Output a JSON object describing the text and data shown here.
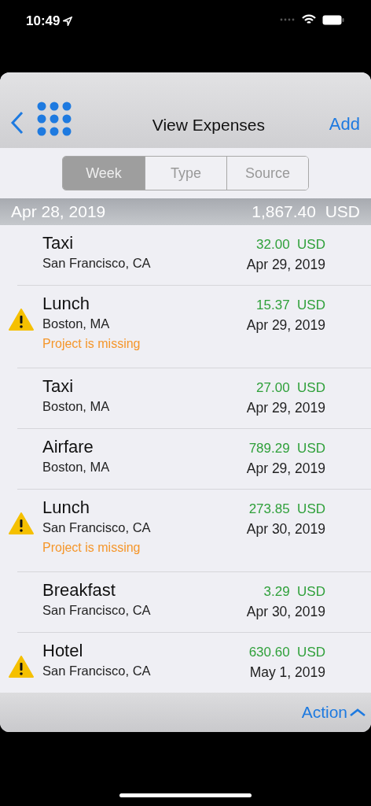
{
  "status_bar": {
    "time": "10:49"
  },
  "nav": {
    "title": "View Expenses",
    "add": "Add"
  },
  "segments": [
    {
      "label": "Week",
      "selected": true
    },
    {
      "label": "Type",
      "selected": false
    },
    {
      "label": "Source",
      "selected": false
    }
  ],
  "section": {
    "date": "Apr 28, 2019",
    "total": "1,867.40  USD"
  },
  "expenses": [
    {
      "title": "Taxi",
      "location": "San Francisco, CA",
      "amount": "32.00  USD",
      "date": "Apr 29, 2019",
      "warning": false
    },
    {
      "title": "Lunch",
      "location": "Boston, MA",
      "amount": "15.37  USD",
      "date": "Apr 29, 2019",
      "warning": true,
      "note": "Project is missing"
    },
    {
      "title": "Taxi",
      "location": "Boston, MA",
      "amount": "27.00  USD",
      "date": "Apr 29, 2019",
      "warning": false
    },
    {
      "title": "Airfare",
      "location": "Boston, MA",
      "amount": "789.29  USD",
      "date": "Apr 29, 2019",
      "warning": false
    },
    {
      "title": "Lunch",
      "location": "San Francisco, CA",
      "amount": "273.85  USD",
      "date": "Apr 30, 2019",
      "warning": true,
      "note": "Project is missing"
    },
    {
      "title": "Breakfast",
      "location": "San Francisco, CA",
      "amount": "3.29  USD",
      "date": "Apr 30, 2019",
      "warning": false
    },
    {
      "title": "Hotel",
      "location": "San Francisco, CA",
      "amount": "630.60  USD",
      "date": "May 1, 2019",
      "warning": true
    }
  ],
  "toolbar": {
    "action": "Action"
  }
}
